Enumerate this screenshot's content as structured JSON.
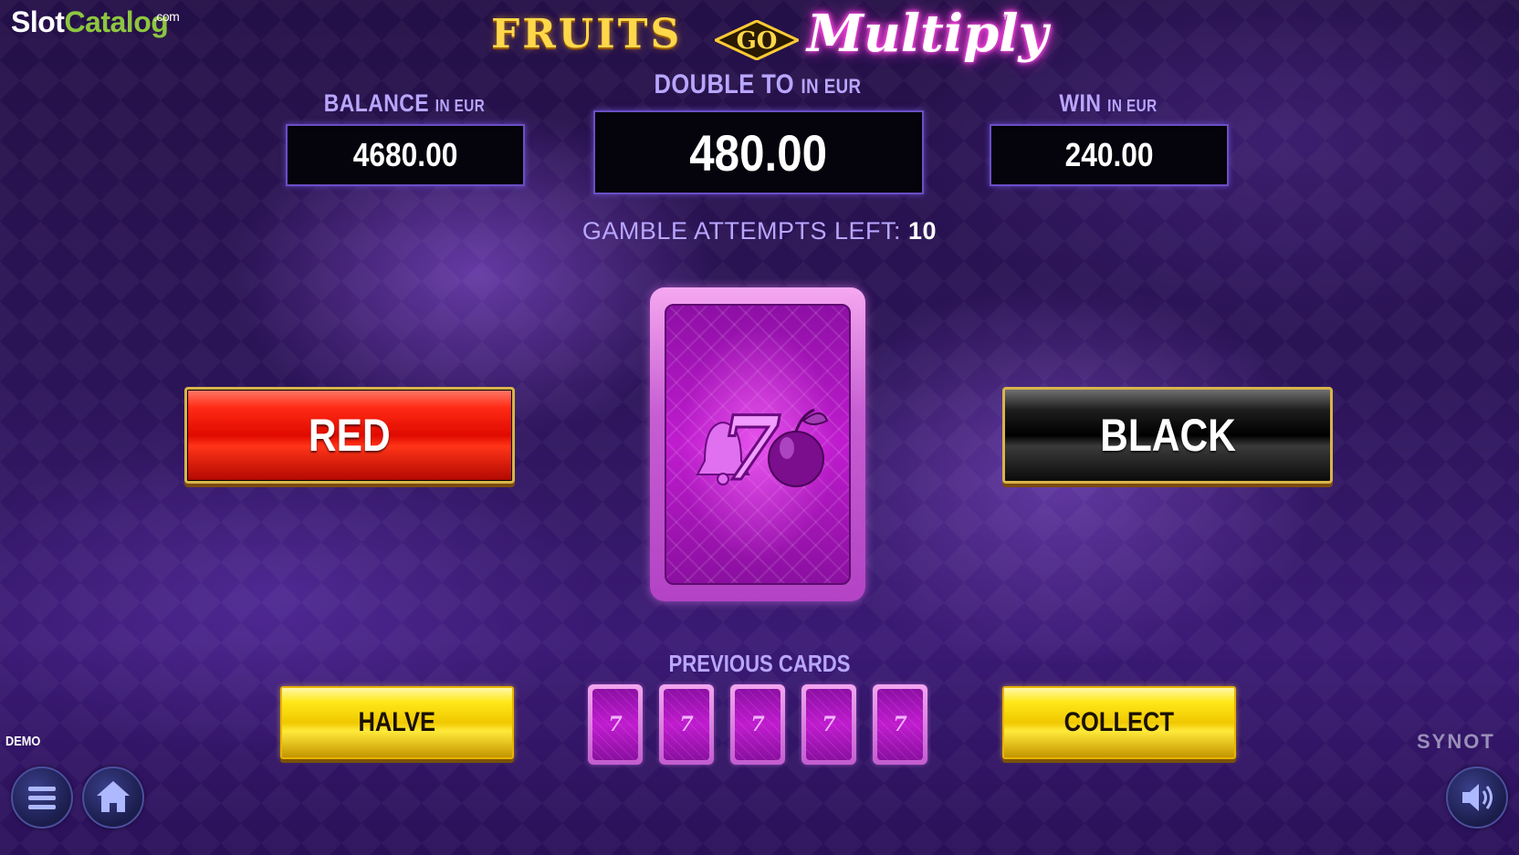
{
  "site_logo": {
    "part1": "Slot",
    "part2": "Catalog",
    "suffix": ".com"
  },
  "game_title": {
    "word1": "FRUITS",
    "word2": "GO",
    "word3": "Multiply",
    "tm": "™"
  },
  "balance": {
    "label": "BALANCE",
    "unit": "IN EUR",
    "value": "4680.00"
  },
  "double_to": {
    "label": "DOUBLE TO",
    "unit": "IN EUR",
    "value": "480.00"
  },
  "win": {
    "label": "WIN",
    "unit": "IN EUR",
    "value": "240.00"
  },
  "attempts": {
    "label": "GAMBLE ATTEMPTS LEFT:",
    "value": "10"
  },
  "buttons": {
    "red": "RED",
    "black": "BLACK",
    "halve": "HALVE",
    "collect": "COLLECT"
  },
  "previous_cards": {
    "label": "PREVIOUS CARDS",
    "cards": [
      "7",
      "7",
      "7",
      "7",
      "7"
    ]
  },
  "mode": "DEMO",
  "provider": "SYNOT",
  "icons": {
    "menu": "menu-icon",
    "home": "home-icon",
    "sound": "sound-icon"
  },
  "colors": {
    "accent_label": "#b9a6ff",
    "red_button": "#e00a00",
    "yellow_button": "#f0c800",
    "card_magenta": "#c01ccf"
  }
}
